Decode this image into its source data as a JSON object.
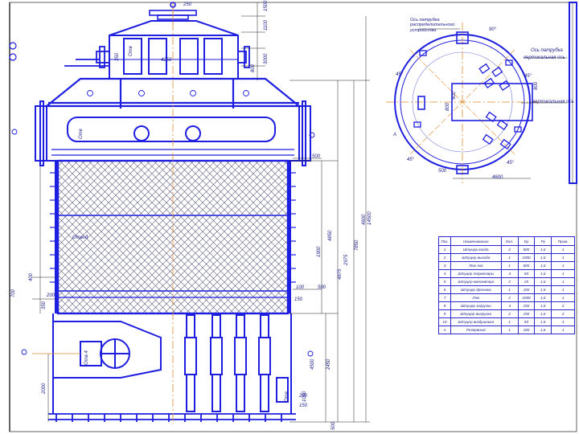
{
  "drawing": {
    "dims_top": [
      "1500",
      "1100",
      "250",
      "350",
      "3000",
      "800"
    ],
    "dims_left": [
      "400",
      "700",
      "350",
      "2000",
      "200"
    ],
    "dims_right": [
      "4600",
      "2975",
      "1900",
      "7850",
      "4875",
      "14500",
      "4850",
      "1050",
      "2450",
      "500"
    ],
    "dims_mid": [
      "500",
      "100",
      "500",
      "150",
      "4500",
      "200",
      "150"
    ],
    "labels": [
      "Отвод",
      "4250",
      "Отв.4",
      "Отв",
      "Отв",
      "Отв"
    ],
    "plan_note": "Ось патрубка распределительного устройства",
    "plan_labels": [
      "90°",
      "Ось патрубка",
      "вертикальная ось",
      "вертикальная ось",
      "800",
      "800",
      "500",
      "500",
      "4600",
      "45°",
      "45°",
      "45°",
      "45°",
      "A"
    ]
  },
  "spec_table": {
    "headers": [
      "Поз.",
      "Наименование",
      "Кол.",
      "Dу",
      "Ру",
      "Прим."
    ],
    "rows": [
      [
        "1",
        "Штуцер входа",
        "2",
        "500",
        "1,6",
        "1"
      ],
      [
        "2",
        "Штуцер выхода",
        "1",
        "1000",
        "1,6",
        "1"
      ],
      [
        "3",
        "Люк-лаз",
        "1",
        "600",
        "1,6",
        "1"
      ],
      [
        "4",
        "Штуцер термопары",
        "4",
        "50",
        "1,6",
        "1"
      ],
      [
        "5",
        "Штуцер манометра",
        "2",
        "25",
        "1,6",
        "1"
      ],
      [
        "6",
        "Штуцер дренажа",
        "1",
        "100",
        "1,6",
        "1"
      ],
      [
        "7",
        "Люк",
        "2",
        "1000",
        "1,6",
        "1"
      ],
      [
        "8",
        "Штуцер загрузки",
        "4",
        "150",
        "1,6",
        "2"
      ],
      [
        "9",
        "Штуцер выгрузки",
        "2",
        "150",
        "1,6",
        "2"
      ],
      [
        "10",
        "Штуцер воздушника",
        "1",
        "50",
        "1,6",
        "1"
      ],
      [
        "А",
        "Резервный",
        "1",
        "100",
        "1,6",
        "1"
      ]
    ]
  },
  "colors": {
    "primary": "#1e1ee0",
    "hatch": "#5a5a7a",
    "axis": "#e08a2a",
    "thin": "#202020",
    "lightline": "#7a7ad8"
  }
}
